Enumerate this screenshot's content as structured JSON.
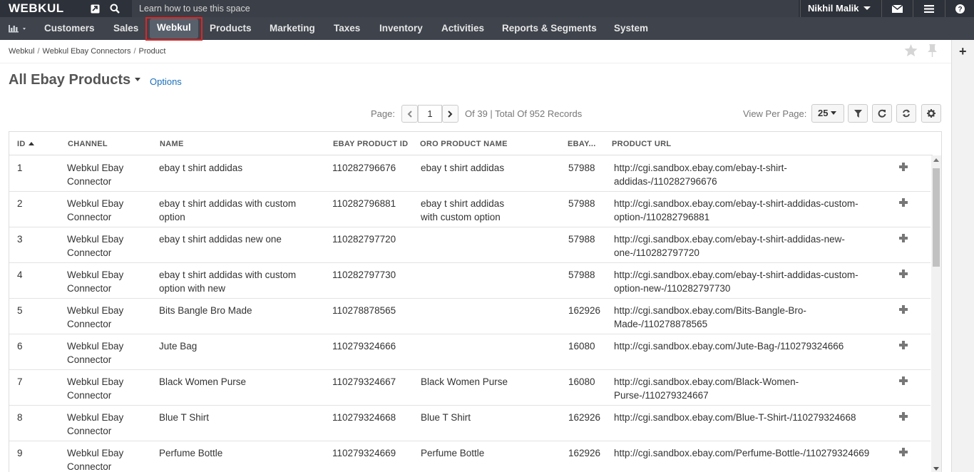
{
  "topbar": {
    "logo": "WEBKUL",
    "learn": "Learn how to use this space",
    "user": "Nikhil Malik"
  },
  "nav": [
    {
      "label": "Customers"
    },
    {
      "label": "Sales"
    },
    {
      "label": "Webkul"
    },
    {
      "label": "Products"
    },
    {
      "label": "Marketing"
    },
    {
      "label": "Taxes"
    },
    {
      "label": "Inventory"
    },
    {
      "label": "Activities"
    },
    {
      "label": "Reports & Segments"
    },
    {
      "label": "System"
    }
  ],
  "breadcrumb": [
    "Webkul",
    "Webkul Ebay Connectors",
    "Product"
  ],
  "page": {
    "title": "All Ebay Products",
    "options": "Options"
  },
  "pager": {
    "label": "Page:",
    "current": "1",
    "info": "Of 39 | Total Of 952 Records",
    "view_per_page_label": "View Per Page:",
    "view_per_page": "25"
  },
  "columns": [
    "ID",
    "CHANNEL",
    "NAME",
    "EBAY PRODUCT ID",
    "ORO PRODUCT NAME",
    "EBAY...",
    "PRODUCT URL"
  ],
  "rows": [
    {
      "id": "1",
      "channel": "Webkul Ebay\nConnector",
      "name": "ebay t shirt addidas",
      "ebay_id": "110282796676",
      "oro_name": "ebay t shirt addidas",
      "cat": "57988",
      "url": "http://cgi.sandbox.ebay.com/ebay-t-shirt-\naddidas-/110282796676"
    },
    {
      "id": "2",
      "channel": "Webkul Ebay\nConnector",
      "name": "ebay t shirt addidas with custom\noption",
      "ebay_id": "110282796881",
      "oro_name": "ebay t shirt addidas\nwith custom option",
      "cat": "57988",
      "url": "http://cgi.sandbox.ebay.com/ebay-t-shirt-addidas-custom-\noption-/110282796881"
    },
    {
      "id": "3",
      "channel": "Webkul Ebay\nConnector",
      "name": "ebay t shirt addidas new one",
      "ebay_id": "110282797720",
      "oro_name": "",
      "cat": "57988",
      "url": "http://cgi.sandbox.ebay.com/ebay-t-shirt-addidas-new-\none-/110282797720"
    },
    {
      "id": "4",
      "channel": "Webkul Ebay\nConnector",
      "name": "ebay t shirt addidas with custom\noption with new",
      "ebay_id": "110282797730",
      "oro_name": "",
      "cat": "57988",
      "url": "http://cgi.sandbox.ebay.com/ebay-t-shirt-addidas-custom-\noption-new-/110282797730"
    },
    {
      "id": "5",
      "channel": "Webkul Ebay\nConnector",
      "name": "Bits Bangle Bro Made",
      "ebay_id": "110278878565",
      "oro_name": "",
      "cat": "162926",
      "url": "http://cgi.sandbox.ebay.com/Bits-Bangle-Bro-\nMade-/110278878565"
    },
    {
      "id": "6",
      "channel": "Webkul Ebay\nConnector",
      "name": "Jute Bag",
      "ebay_id": "110279324666",
      "oro_name": "",
      "cat": "16080",
      "url": "http://cgi.sandbox.ebay.com/Jute-Bag-/110279324666"
    },
    {
      "id": "7",
      "channel": "Webkul Ebay\nConnector",
      "name": "Black Women Purse",
      "ebay_id": "110279324667",
      "oro_name": "Black Women Purse",
      "cat": "16080",
      "url": "http://cgi.sandbox.ebay.com/Black-Women-\nPurse-/110279324667"
    },
    {
      "id": "8",
      "channel": "Webkul Ebay\nConnector",
      "name": "Blue T Shirt",
      "ebay_id": "110279324668",
      "oro_name": "Blue T Shirt",
      "cat": "162926",
      "url": "http://cgi.sandbox.ebay.com/Blue-T-Shirt-/110279324668"
    },
    {
      "id": "9",
      "channel": "Webkul Ebay\nConnector",
      "name": "Perfume Bottle",
      "ebay_id": "110279324669",
      "oro_name": "Perfume Bottle",
      "cat": "162926",
      "url": "http://cgi.sandbox.ebay.com/Perfume-Bottle-/110279324669"
    }
  ]
}
